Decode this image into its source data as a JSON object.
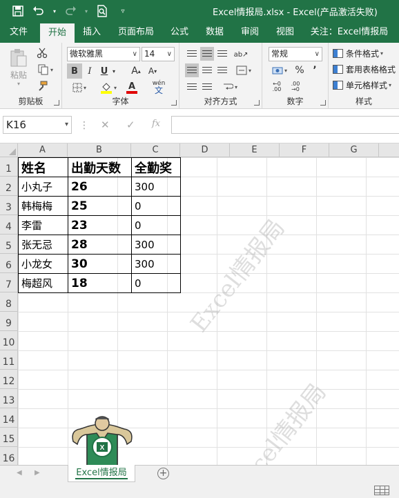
{
  "window": {
    "title": "Excel情报局.xlsx  -  Excel(产品激活失败)"
  },
  "ribbon_tabs": [
    {
      "label": "文件",
      "active": false
    },
    {
      "label": "开始",
      "active": true
    },
    {
      "label": "插入",
      "active": false
    },
    {
      "label": "页面布局",
      "active": false
    },
    {
      "label": "公式",
      "active": false
    },
    {
      "label": "数据",
      "active": false
    },
    {
      "label": "审阅",
      "active": false
    },
    {
      "label": "视图",
      "active": false
    },
    {
      "label": "关注：Excel情报局",
      "active": false
    }
  ],
  "ribbon": {
    "clipboard": {
      "paste_label": "粘贴",
      "group_label": "剪贴板"
    },
    "font": {
      "font_name": "微软雅黑",
      "font_size": "14",
      "group_label": "字体",
      "bold": "B",
      "italic": "I",
      "underline": "U",
      "grow": "A",
      "shrink": "A",
      "phonetic": "wén",
      "font_color_letter": "A"
    },
    "alignment": {
      "group_label": "对齐方式"
    },
    "number": {
      "format": "常规",
      "group_label": "数字",
      "percent": "%",
      "comma": "’",
      "dec_inc": "←0 .00",
      "dec_dec": ".00 →0"
    },
    "styles": {
      "group_label": "样式",
      "conditional": "条件格式",
      "table": "套用表格格式",
      "cell": "单元格样式"
    }
  },
  "formula_bar": {
    "name_box": "K16",
    "fx": "fx",
    "formula": ""
  },
  "grid": {
    "columns": [
      "A",
      "B",
      "C",
      "D",
      "E",
      "F",
      "G"
    ],
    "rows": [
      "1",
      "2",
      "3",
      "4",
      "5",
      "6",
      "7",
      "8",
      "9",
      "10",
      "11",
      "12",
      "13",
      "14",
      "15",
      "16"
    ],
    "table": {
      "headers": [
        "姓名",
        "出勤天数",
        "全勤奖"
      ],
      "records": [
        [
          "小丸子",
          "26",
          "300"
        ],
        [
          "韩梅梅",
          "25",
          "0"
        ],
        [
          "李雷",
          "23",
          "0"
        ],
        [
          "张无忌",
          "28",
          "300"
        ],
        [
          "小龙女",
          "30",
          "300"
        ],
        [
          "梅超风",
          "18",
          "0"
        ]
      ]
    },
    "watermark": "Excel情报局"
  },
  "sheets": [
    {
      "label": "Excel情报局",
      "active": true
    }
  ],
  "colors": {
    "brand_green": "#217346",
    "ribbon_bg": "#f3f3f3"
  }
}
